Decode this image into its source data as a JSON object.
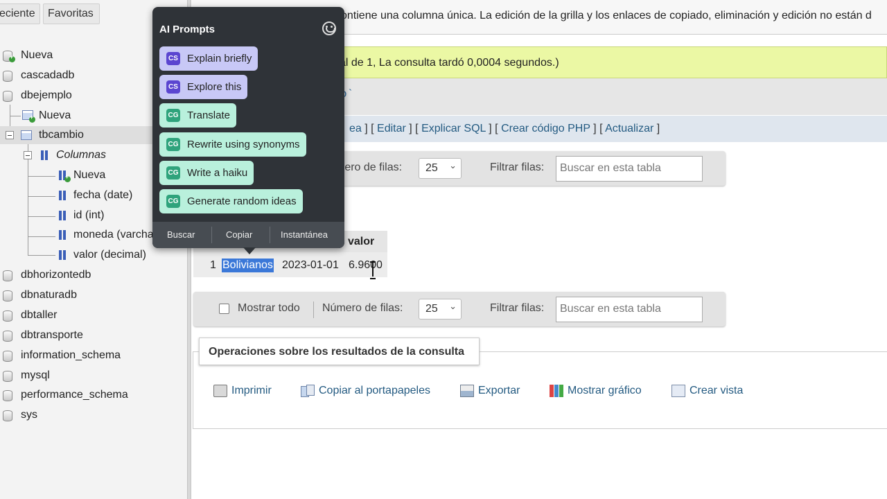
{
  "nav": {
    "tabs": [
      "eciente",
      "Favoritas"
    ],
    "tree": {
      "root_new": "Nueva",
      "db1": "cascadadb",
      "db2": "dbejemplo",
      "db2_new": "Nueva",
      "table": "tbcambio",
      "columns_group": "Columnas",
      "columns_new": "Nueva",
      "columns": [
        "fecha (date)",
        "id (int)",
        "moneda (varcha",
        "valor (decimal)"
      ],
      "dbs_after": [
        "dbhorizontedb",
        "dbnaturadb",
        "dbtaller",
        "dbtransporte",
        "information_schema",
        "mysql",
        "performance_schema",
        "sys"
      ]
    }
  },
  "main": {
    "notice": "ontiene una columna única. La edición de la grilla y los enlaces de copiado, eliminación y edición no están d",
    "success": "al de 1, La consulta tardó 0,0004 segundos.)",
    "sql_fragment": "o`",
    "sql_links": {
      "partial": "ea",
      "edit": "Editar",
      "explain": "Explicar SQL",
      "php": "Crear código PHP",
      "refresh": "Actualizar"
    },
    "navbar_top": {
      "rows_label": "mero de filas:",
      "rows_value": "25",
      "filter_label": "Filtrar filas:",
      "search_placeholder": "Buscar en esta tabla"
    },
    "navbar_bottom": {
      "show_all": "Mostrar todo",
      "rows_label": "Número de filas:",
      "rows_value": "25",
      "filter_label": "Filtrar filas:",
      "search_placeholder": "Buscar en esta tabla"
    },
    "results": {
      "header_visible": "valor",
      "row": {
        "id": "1",
        "moneda": "Bolivianos",
        "fecha": "2023-01-01",
        "valor": "6.9600"
      }
    },
    "operations": {
      "title": "Operaciones sobre los resultados de la consulta",
      "items": [
        "Imprimir",
        "Copiar al portapapeles",
        "Exportar",
        "Mostrar gráfico",
        "Crear vista"
      ]
    }
  },
  "popup": {
    "title": "AI Prompts",
    "prompts": [
      {
        "badge": "CS",
        "label": "Explain briefly"
      },
      {
        "badge": "CS",
        "label": "Explore this"
      },
      {
        "badge": "CG",
        "label": "Translate"
      },
      {
        "badge": "CG",
        "label": "Rewrite using synonyms"
      },
      {
        "badge": "CG",
        "label": "Write a haiku"
      },
      {
        "badge": "CG",
        "label": "Generate random ideas"
      }
    ],
    "footer": [
      "Buscar",
      "Copiar",
      "Instantánea"
    ]
  },
  "colors": {
    "popup_bg": "#2f3338",
    "cs_chip": "#c8c8f6",
    "cg_chip": "#b9f0dc",
    "success_bg": "#ebf8a4",
    "link": "#235a81",
    "selection": "#3b78d8"
  }
}
